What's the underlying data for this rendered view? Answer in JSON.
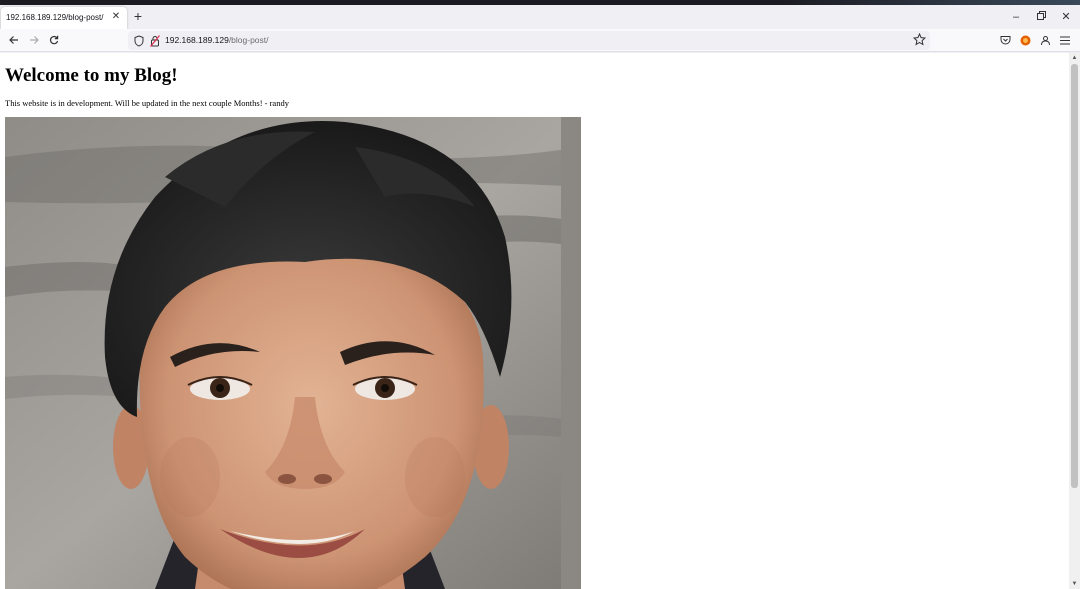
{
  "browser": {
    "tab": {
      "title": "192.168.189.129/blog-post/",
      "close_icon": "close-icon"
    },
    "new_tab_icon": "plus-icon",
    "window_controls": [
      "minimize-icon",
      "restore-icon",
      "close-icon"
    ],
    "nav": {
      "back_icon": "arrow-left-icon",
      "forward_icon": "arrow-right-icon",
      "reload_icon": "reload-icon"
    },
    "url": {
      "host": "192.168.189.129",
      "path": "/blog-post/"
    },
    "toolbar_icons": [
      "pocket-icon",
      "extension-icon",
      "account-icon",
      "menu-icon"
    ]
  },
  "page": {
    "title": "Welcome to my Blog!",
    "text": "This website is in development. Will be updated in the next couple Months! - randy",
    "image": "portrait-photo"
  },
  "colors": {
    "toolbar": "#f9f9fb",
    "tab_strip": "#f0f0f4",
    "page_background": "#ffffff",
    "extension_accent": "#e66000"
  }
}
